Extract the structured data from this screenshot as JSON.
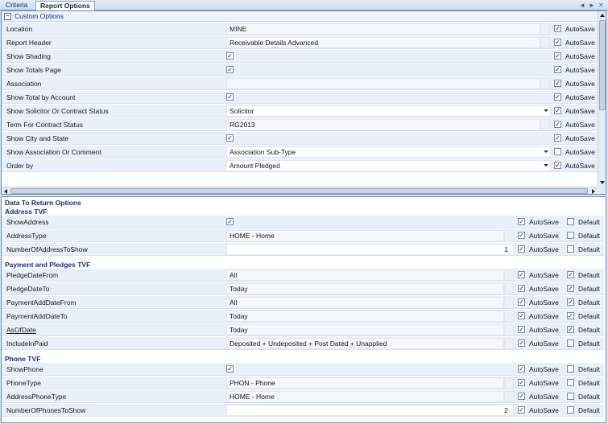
{
  "tabs": {
    "criteria": "Criteria",
    "report_options": "Report Options",
    "controls": {
      "prev": "◄",
      "next": "►",
      "close": "✕"
    }
  },
  "custom_options": {
    "title": "Custom Options",
    "toggle": "−",
    "autosave_label": "AutoSave",
    "rows": [
      {
        "label": "Location",
        "value": "MINE",
        "autosave": "✓"
      },
      {
        "label": "Report Header",
        "value": "Receivable Details Advanced",
        "autosave": "✓"
      },
      {
        "label": "Show Shading",
        "check": "✓",
        "autosave": "✓"
      },
      {
        "label": "Show Totals Page",
        "check": "✓",
        "autosave": "✓"
      },
      {
        "label": "Association",
        "value": "",
        "autosave": "✓"
      },
      {
        "label": "Show Total by Account",
        "check": "✓",
        "autosave": "✓"
      },
      {
        "label": "Show Solicitor Or Contract Status",
        "value": "Solicitor",
        "autosave": "✓"
      },
      {
        "label": "Term For Contract Status",
        "value": "RG2013",
        "autosave": "✓"
      },
      {
        "label": "Show City and State",
        "check": "✓",
        "autosave": "✓"
      },
      {
        "label": "Show Association Or Comment",
        "value": "Association Sub-Type",
        "autosave": ""
      },
      {
        "label": "Order by",
        "value": "Amount Pledged",
        "autosave": "✓"
      }
    ]
  },
  "data_to_return": {
    "title": "Data To Return Options",
    "autosave_label": "AutoSave",
    "default_label": "Default",
    "groups": {
      "address": {
        "title": "Address TVF",
        "rows": [
          {
            "label": "ShowAddress",
            "check": "✓",
            "autosave": "✓",
            "default": ""
          },
          {
            "label": "AddressType",
            "value": "HOME - Home",
            "autosave": "✓",
            "default": ""
          },
          {
            "label": "NumberOfAddressToShow",
            "value": "1",
            "autosave": "✓",
            "default": ""
          }
        ]
      },
      "payment": {
        "title": "Payment and Pledges TVF",
        "rows": [
          {
            "label": "PledgeDateFrom",
            "value": "All",
            "autosave": "✓",
            "default": "✓"
          },
          {
            "label": "PledgeDateTo",
            "value": "Today",
            "autosave": "✓",
            "default": "✓"
          },
          {
            "label": "PaymentAddDateFrom",
            "value": "All",
            "autosave": "✓",
            "default": "✓"
          },
          {
            "label": "PaymentAddDateTo",
            "value": "Today",
            "autosave": "✓",
            "default": "✓"
          },
          {
            "label": "AsOfDate",
            "value": "Today",
            "autosave": "✓",
            "default": "✓"
          },
          {
            "label": "IncludeInPaid",
            "value": "Deposited + Undeposited + Post Dated + Unapplied",
            "autosave": "✓",
            "default": ""
          }
        ]
      },
      "phone": {
        "title": "Phone TVF",
        "rows": [
          {
            "label": "ShowPhone",
            "check": "✓",
            "autosave": "✓",
            "default": ""
          },
          {
            "label": "PhoneType",
            "value": "PHON - Phone",
            "autosave": "✓",
            "default": ""
          },
          {
            "label": "AddressPhoneType",
            "value": "HOME - Home",
            "autosave": "✓",
            "default": ""
          },
          {
            "label": "NumberOfPhonesToShow",
            "value": "2",
            "autosave": "✓",
            "default": ""
          }
        ]
      }
    }
  }
}
